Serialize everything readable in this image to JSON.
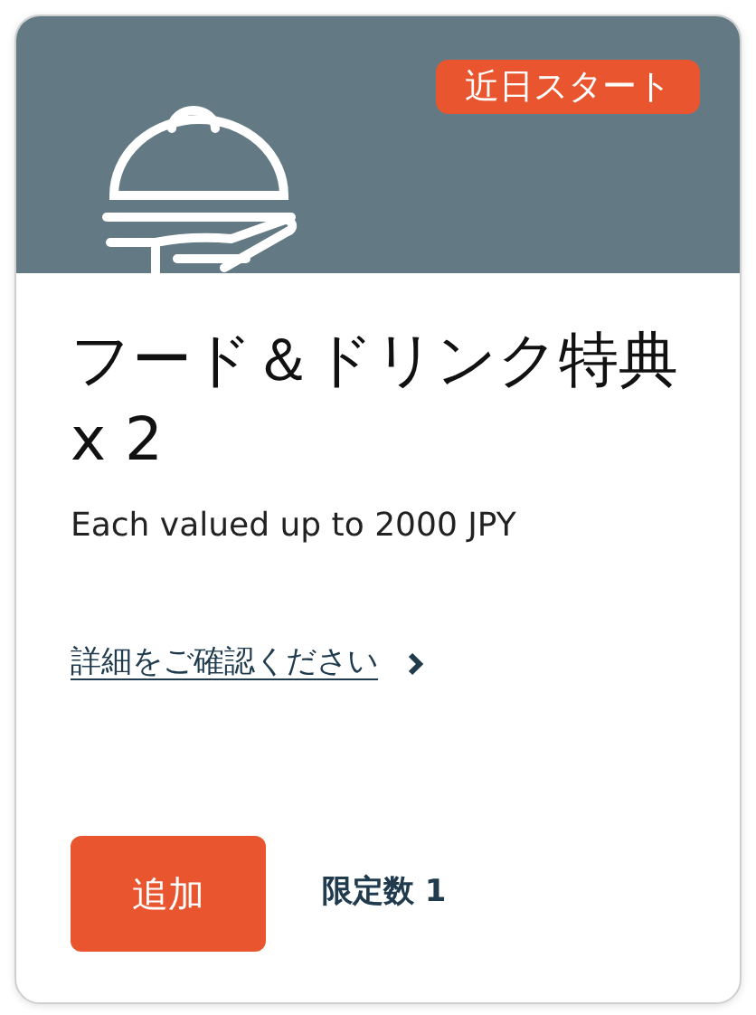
{
  "badge": "近日スタート",
  "title": "フード＆ドリンク特典 x 2",
  "subtitle": "Each valued up to 2000 JPY",
  "details_link": "詳細をご確認ください",
  "add_button": "追加",
  "limit": "限定数 1"
}
